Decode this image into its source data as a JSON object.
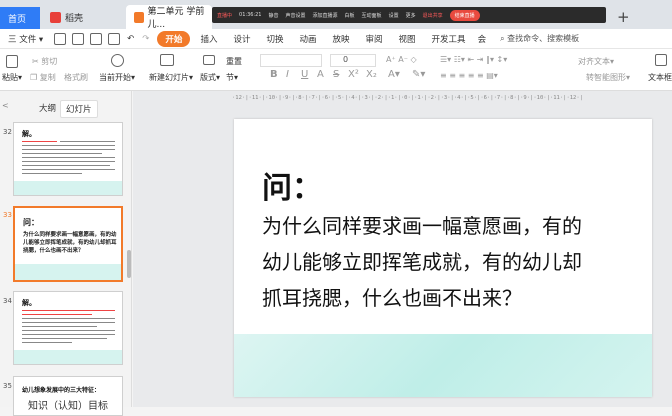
{
  "titlebar": {
    "tab_home": "首页",
    "tab_docer": "稻壳",
    "tab_doc": "第二单元 学前儿...",
    "live_items": [
      "直播中",
      "01:36:21",
      "静音",
      "声音设置",
      "添加直播源",
      "白板",
      "互动面板",
      "设置",
      "更多",
      "退出共享",
      "结束直播"
    ],
    "plus": "+"
  },
  "menubar": {
    "file": "三 文件 ▾",
    "items": [
      "开始",
      "插入",
      "设计",
      "切换",
      "动画",
      "放映",
      "审阅",
      "视图",
      "开发工具",
      "会"
    ],
    "search": "查找命令、搜索模板"
  },
  "ribbon": {
    "paste": "粘贴▾",
    "cut": "剪切",
    "copy": "复制",
    "format_painter": "格式刷",
    "from_current": "当前开始▾",
    "new_slide": "新建幻灯片▾",
    "layout": "版式▾",
    "section": "节▾",
    "reset": "重置",
    "font_size": "0",
    "text_align": "对齐文本▾",
    "smartart": "转智能图形▾",
    "textbox": "文本框"
  },
  "leftpanel": {
    "tab_outline": "大纲",
    "tab_slides": "幻灯片",
    "slides": [
      {
        "num": "32",
        "title": "解。"
      },
      {
        "num": "33",
        "title": "问：",
        "text": "为什么同样要求画一幅意愿画，有的幼儿能够立即挥笔成就，有的幼儿却抓耳挠腮，什么也画不出来？"
      },
      {
        "num": "34",
        "title": "解。"
      },
      {
        "num": "35",
        "title": "幼儿想象发展中的三大特征：",
        "text": "知识（认知）目标"
      }
    ]
  },
  "ruler": "·12·|·11·|·10·|·9·|·8·|·7·|·6·|·5·|·4·|·3·|·2·|·1·|·0·|·1·|·2·|·3·|·4·|·5·|·6·|·7·|·8·|·9·|·10·|·11·|·12·|",
  "slide": {
    "title": "问：",
    "body_lines": [
      "为什么同样要求画一幅意愿画，有的",
      "幼儿能够立即挥笔成就，有的幼儿却",
      "抓耳挠腮，什么也画不出来？"
    ]
  },
  "colors": {
    "accent": "#f27a2a",
    "home_tab": "#2f7cf6",
    "band": "#bfeee8"
  }
}
